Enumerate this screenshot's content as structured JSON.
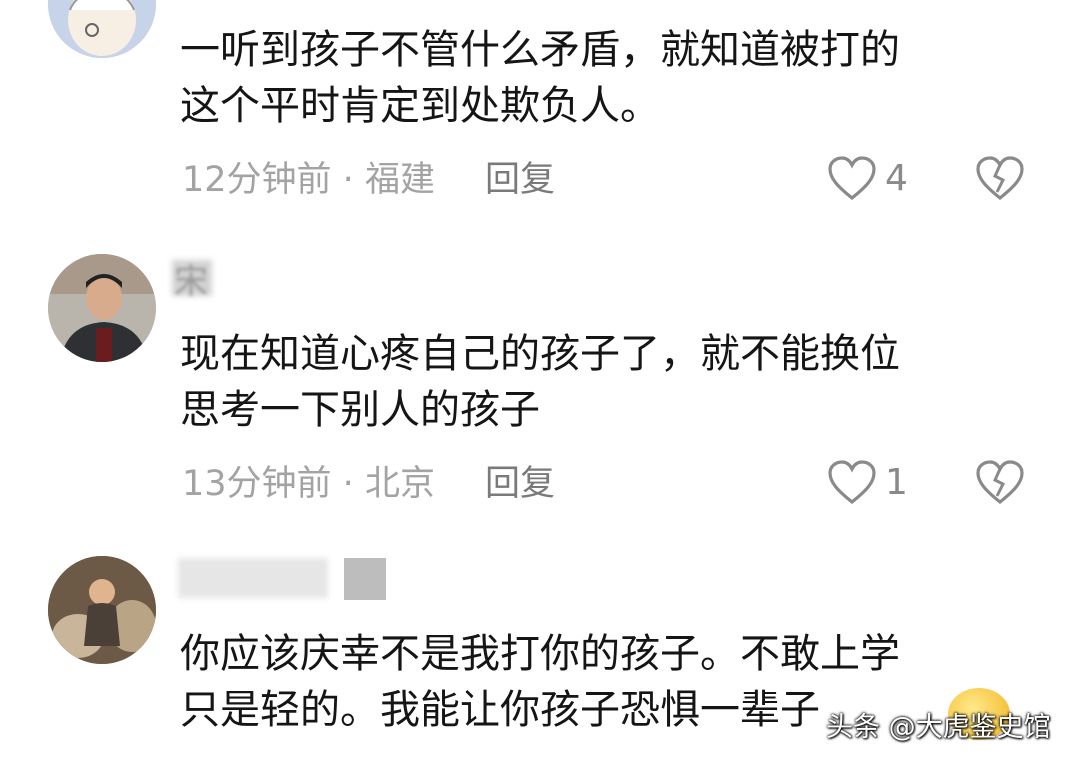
{
  "comments": [
    {
      "text": "一听到孩子不管什么矛盾，就知道被打的\n这个平时肯定到处欺负人。",
      "time": "12分钟前",
      "location": "福建",
      "reply_label": "回复",
      "likes": "4",
      "avatar_icon": "cartoon-avatar"
    },
    {
      "username": "宋",
      "text": "现在知道心疼自己的孩子了，就不能换位\n思考一下别人的孩子",
      "time": "13分钟前",
      "location": "北京",
      "reply_label": "回复",
      "likes": "1",
      "avatar_icon": "man-avatar"
    },
    {
      "text": "你应该庆幸不是我打你的孩子。不敢上学\n只是轻的。我能让你孩子恐惧一辈子",
      "avatar_icon": "child-avatar"
    }
  ],
  "separator": " · ",
  "watermark": "头条 @大虎鉴史馆",
  "colors": {
    "text": "#151515",
    "meta": "#a3a3a3",
    "icon": "#8a8a8a"
  }
}
